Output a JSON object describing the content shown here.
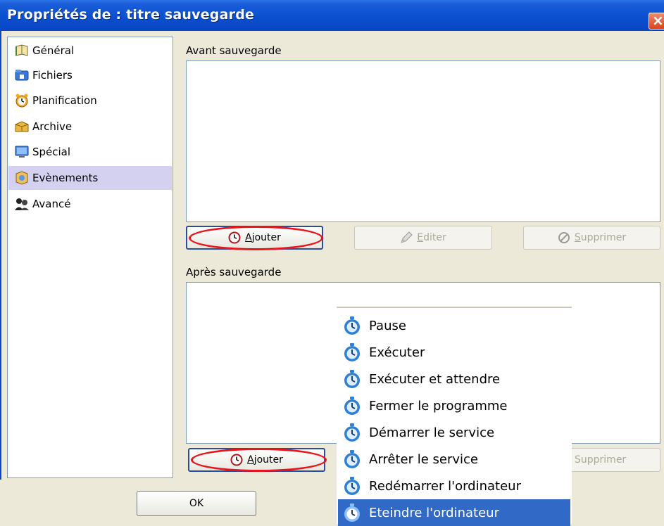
{
  "window": {
    "title": "Propriétés de : titre sauvegarde",
    "close_label": "×"
  },
  "sidebar": {
    "items": [
      {
        "label": "Général",
        "icon": "book-icon"
      },
      {
        "label": "Fichiers",
        "icon": "folder-icon"
      },
      {
        "label": "Planification",
        "icon": "alarm-clock-icon"
      },
      {
        "label": "Archive",
        "icon": "archive-box-icon"
      },
      {
        "label": "Spécial",
        "icon": "monitor-icon"
      },
      {
        "label": "Evènements",
        "icon": "events-icon",
        "selected": true
      },
      {
        "label": "Avancé",
        "icon": "people-icon"
      }
    ]
  },
  "before": {
    "label": "Avant sauvegarde",
    "add": {
      "before": "",
      "mnemonic": "A",
      "after": "jouter"
    },
    "edit": {
      "before": "",
      "mnemonic": "E",
      "after": "diter"
    },
    "delete": {
      "before": "",
      "mnemonic": "S",
      "after": "upprimer"
    }
  },
  "after": {
    "label": "Après sauvegarde",
    "add": {
      "before": "",
      "mnemonic": "A",
      "after": "jouter"
    },
    "delete_text": "Supprimer"
  },
  "footer": {
    "ok_label": "OK"
  },
  "context_menu": {
    "items": [
      {
        "label": "Pause"
      },
      {
        "label": "Exécuter"
      },
      {
        "label": "Exécuter et attendre"
      },
      {
        "label": "Fermer le programme"
      },
      {
        "label": "Démarrer le service"
      },
      {
        "label": "Arrêter le service"
      },
      {
        "label": "Redémarrer l'ordinateur"
      },
      {
        "label": "Eteindre l'ordinateur",
        "highlighted": true
      }
    ]
  },
  "colors": {
    "title_bar": "#0a4fd0",
    "selection": "#3169c6",
    "sidebar_selected": "#d4d0f0",
    "annotation": "#e8151c"
  }
}
